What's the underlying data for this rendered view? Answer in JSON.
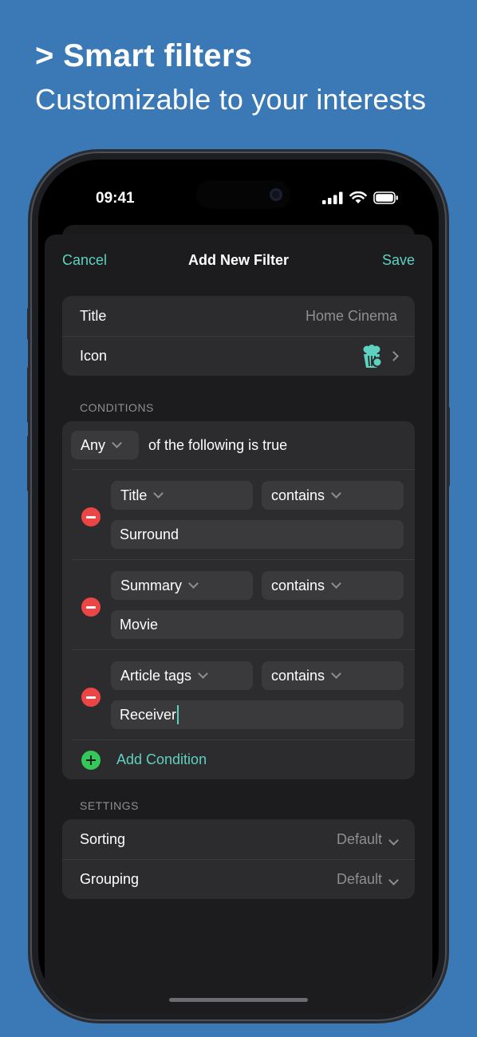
{
  "headline": "> Smart filters",
  "subline": "Customizable to your interests",
  "status": {
    "time": "09:41"
  },
  "nav": {
    "cancel": "Cancel",
    "title": "Add New Filter",
    "save": "Save"
  },
  "basic": {
    "title_label": "Title",
    "title_value": "Home Cinema",
    "icon_label": "Icon",
    "icon_name": "popcorn-icon"
  },
  "conditions": {
    "section": "CONDITIONS",
    "match_mode": "Any",
    "match_text": "of the following is true",
    "items": [
      {
        "field": "Title",
        "operator": "contains",
        "value": "Surround"
      },
      {
        "field": "Summary",
        "operator": "contains",
        "value": "Movie"
      },
      {
        "field": "Article tags",
        "operator": "contains",
        "value": "Receiver"
      }
    ],
    "add_label": "Add Condition"
  },
  "settings": {
    "section": "SETTINGS",
    "sorting_label": "Sorting",
    "sorting_value": "Default",
    "grouping_label": "Grouping",
    "grouping_value": "Default"
  },
  "colors": {
    "accent": "#5fd1c0",
    "background": "#3a78b6",
    "remove": "#eb4545",
    "add": "#34c759"
  }
}
